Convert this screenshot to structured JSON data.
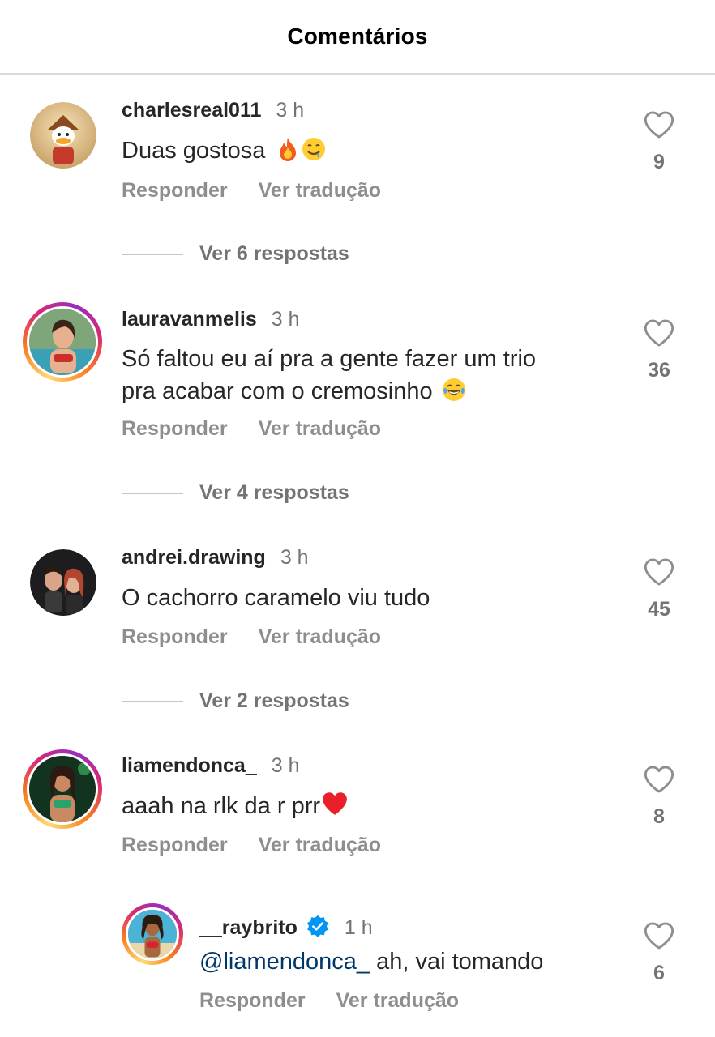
{
  "header": {
    "title": "Comentários"
  },
  "actions": {
    "reply": "Responder",
    "translate": "Ver tradução"
  },
  "comments": [
    {
      "username": "charlesreal011",
      "time": "3 h",
      "text": "Duas gostosa",
      "emojis": [
        "fire-emoji",
        "drooling-face-emoji"
      ],
      "likes": "9",
      "replies": "Ver 6 respostas"
    },
    {
      "username": "lauravanmelis",
      "time": "3 h",
      "text_line1": "Só faltou eu aí pra a gente fazer um trio",
      "text_line2": "pra acabar com o cremosinho",
      "emojis": [
        "tears-of-joy-emoji"
      ],
      "likes": "36",
      "replies": "Ver 4 respostas"
    },
    {
      "username": "andrei.drawing",
      "time": "3 h",
      "text": "O cachorro caramelo viu tudo",
      "likes": "45",
      "replies": "Ver 2 respostas"
    },
    {
      "username": "liamendonca_",
      "time": "3 h",
      "text": "aaah na rlk da r prr",
      "emojis": [
        "red-heart-emoji"
      ],
      "likes": "8"
    },
    {
      "username": "__raybrito",
      "time": "1 h",
      "mention": "@liamendonca_",
      "text": " ah, vai tomando",
      "likes": "6",
      "verified": true
    }
  ],
  "colors": {
    "mention": "#00376b",
    "verified": "#0095f6",
    "muted": "#737373"
  }
}
